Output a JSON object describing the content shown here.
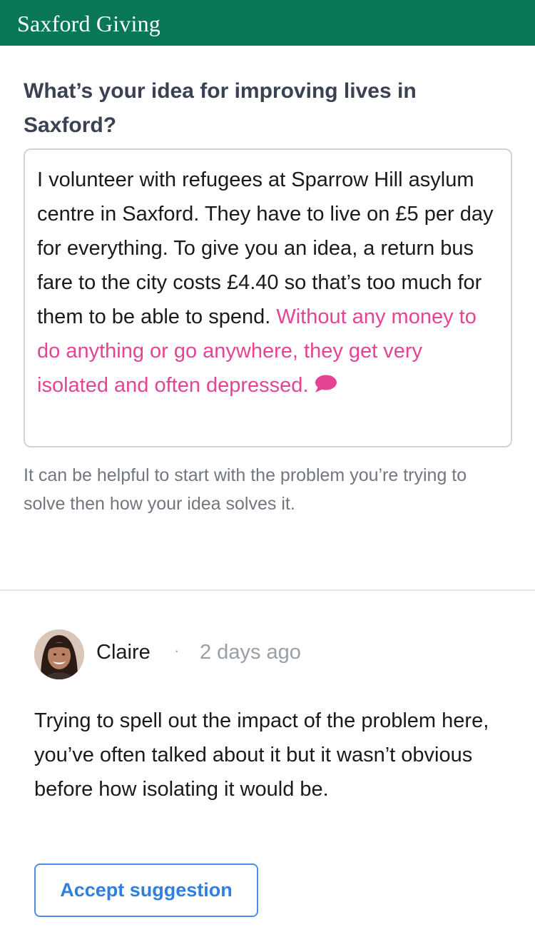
{
  "header": {
    "brand": "Saxford Giving",
    "background_color": "#077755"
  },
  "form": {
    "question": "What’s your idea for improving lives in Saxford?",
    "answer": {
      "plain_text": "I volunteer with refugees at Sparrow Hill asylum centre in Saxford. They have to live on £5 per day for everything. To give you an idea, a return bus fare to the city costs £4.40 so that’s too much for them to be able to spend.",
      "highlighted_text": "Without any money to do anything or go anywhere, they get very isolated and often depressed.",
      "highlight_color": "#e64394",
      "comment_icon": "speech-bubble-icon"
    },
    "hint": "It can be helpful to start with the problem you’re trying to solve then how your idea solves it."
  },
  "comment": {
    "author": "Claire",
    "separator": "·",
    "time": "2 days ago",
    "avatar_icon": "user-avatar",
    "body": "Trying to spell out the impact of the problem here, you’ve often talked about it but it wasn’t obvious before how isolating it would be.",
    "accept_label": "Accept suggestion",
    "accept_color": "#2f7fe0"
  }
}
